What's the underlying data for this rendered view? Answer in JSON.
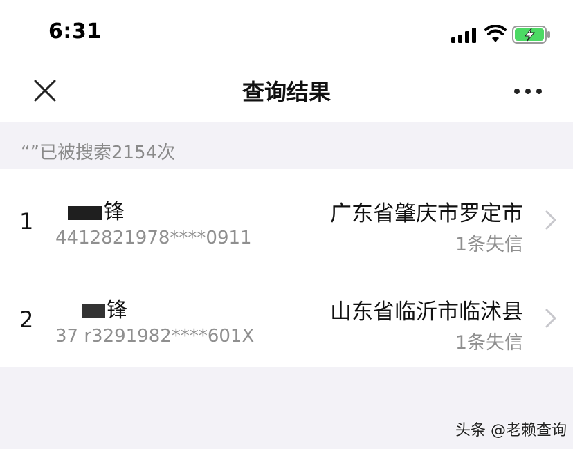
{
  "status_bar": {
    "time": "6:31",
    "icons": [
      "cellular-signal-icon",
      "wifi-icon",
      "battery-charging-icon"
    ],
    "battery_color": "#4cd964"
  },
  "nav": {
    "title": "查询结果",
    "close_icon": "close-icon",
    "more_icon": "more-icon"
  },
  "search_info": "“”已被搜索2154次",
  "results": [
    {
      "index": "1",
      "name": "锋",
      "id_number": "4412821978****0911",
      "location": "广东省肇庆市罗定市",
      "record": "1条失信"
    },
    {
      "index": "2",
      "name": "锋",
      "id_number": "37 r3291982****601X",
      "location": "山东省临沂市临沭县",
      "record": "1条失信"
    }
  ],
  "watermark": "头条 @老赖查询",
  "colors": {
    "page_background": "#f3f2f7",
    "secondary_text": "#8f8f8f"
  }
}
